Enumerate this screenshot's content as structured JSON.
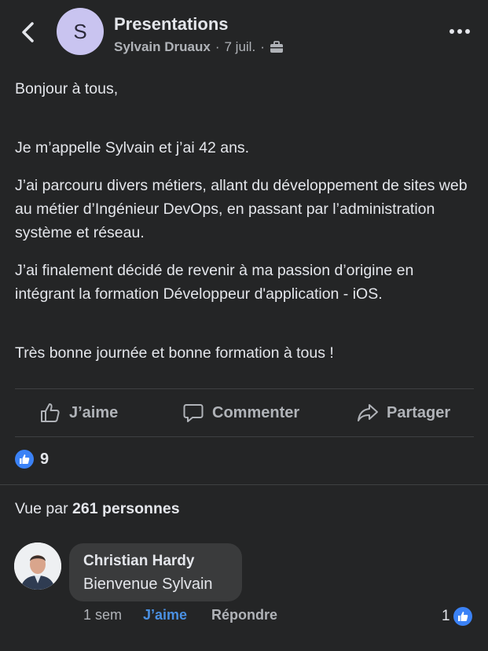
{
  "header": {
    "group_initial": "S",
    "title": "Presentations",
    "author": "Sylvain Druaux",
    "date": "7 juil.",
    "separator": "·"
  },
  "post": {
    "paragraphs": [
      "Bonjour à tous,",
      "Je m’appelle Sylvain et j’ai 42 ans.",
      "J’ai parcouru divers métiers, allant du développement de sites web au métier d’Ingénieur DevOps, en passant par l’administration système et réseau.",
      "J’ai finalement décidé de revenir à ma passion d’origine en intégrant la formation Développeur d'application - iOS.",
      "Très bonne journée et bonne formation à tous !"
    ]
  },
  "actions": {
    "like_label": "J’aime",
    "comment_label": "Commenter",
    "share_label": "Partager"
  },
  "reactions": {
    "count": "9"
  },
  "views": {
    "prefix": "Vue par",
    "count_text": "261 personnes"
  },
  "comment": {
    "author": "Christian Hardy",
    "text": "Bienvenue Sylvain",
    "time": "1 sem",
    "like_label": "J’aime",
    "reply_label": "Répondre",
    "like_count": "1"
  },
  "colors": {
    "accent": "#4a90e2",
    "background": "#242526",
    "bubble": "#3a3b3c"
  },
  "icons": [
    "back-chevron-icon",
    "briefcase-icon",
    "more-icon",
    "thumbs-up-icon",
    "comment-icon",
    "share-icon",
    "like-badge-icon"
  ]
}
